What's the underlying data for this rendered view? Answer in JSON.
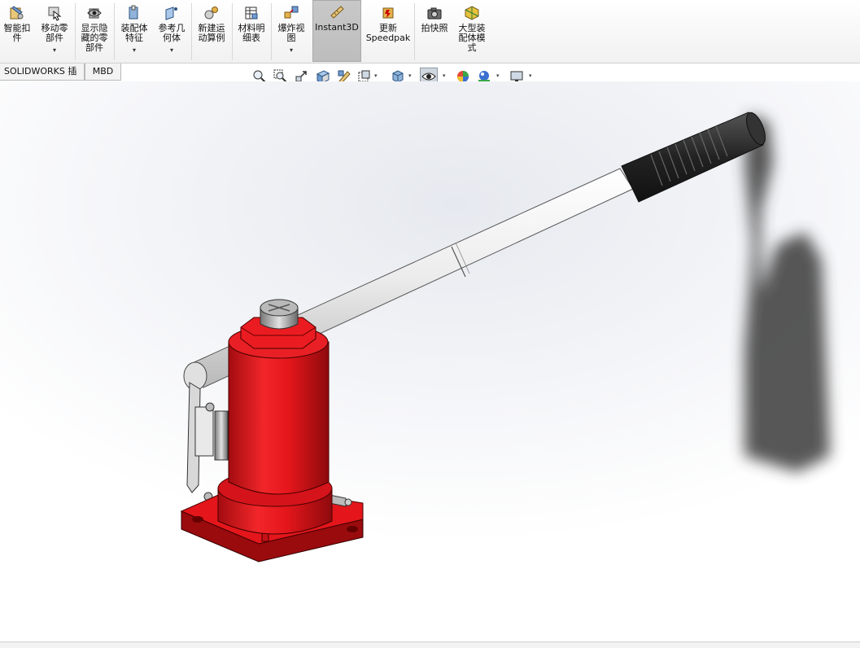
{
  "ribbon": {
    "smart_fastener": "智能扣\n件",
    "move_component": "移动零\n部件",
    "show_hidden": "显示隐\n藏的零\n部件",
    "assembly_features": "装配体\n特征",
    "reference_geometry": "参考几\n何体",
    "new_motion_study": "新建运\n动算例",
    "bom": "材料明\n细表",
    "exploded_view": "爆炸视\n图",
    "instant3d": "Instant3D",
    "update_speedpak": "更新\nSpeedpak",
    "snapshot": "拍快照",
    "large_assembly_mode": "大型装\n配体模\n式",
    "dropdown_glyph": "▾"
  },
  "tabs": {
    "solidworks_addins": "SOLIDWORKS 插件",
    "mbd": "MBD"
  },
  "hud": {
    "dropdown_glyph": "▾"
  },
  "model": {
    "body_color": "#e4161b",
    "handle_color": "#f3f3f3",
    "grip_color": "#222222",
    "shadow_color": "#3a3a3a"
  }
}
